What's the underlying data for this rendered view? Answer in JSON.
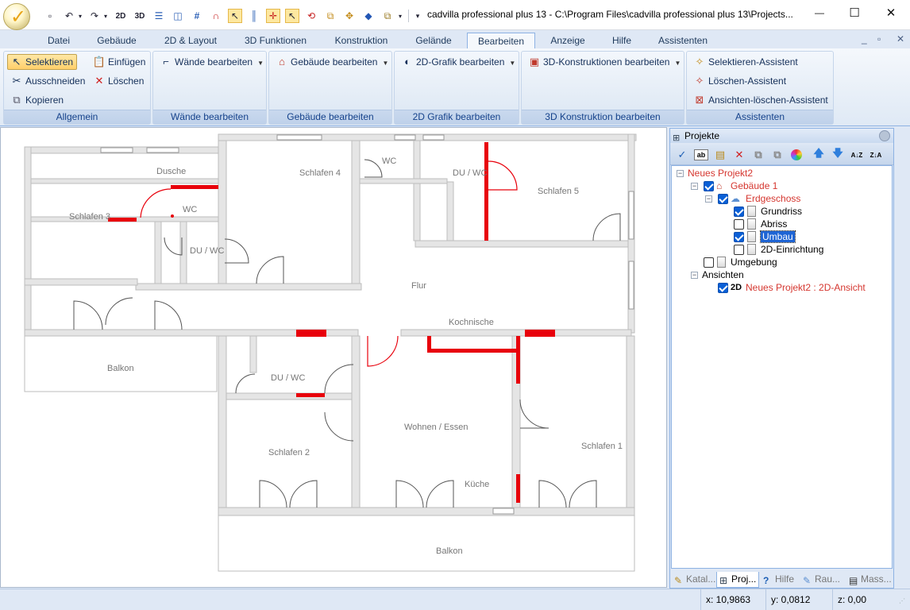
{
  "window": {
    "title": "cadvilla professional plus 13 - C:\\Program Files\\cadvilla professional plus 13\\Projects...",
    "minimize": "—",
    "maximize": "☐",
    "close": "✕"
  },
  "quick_access": {
    "buttons": [
      {
        "icon": "new-document-icon",
        "glyph": "▫"
      },
      {
        "icon": "undo-icon",
        "glyph": "↶"
      },
      {
        "icon": "redo-icon",
        "glyph": "↷"
      },
      {
        "icon": "view-2d-icon",
        "glyph": "2D"
      },
      {
        "icon": "view-3d-icon",
        "glyph": "3D"
      },
      {
        "icon": "split-horizontal-icon",
        "glyph": "☰"
      },
      {
        "icon": "split-vertical-icon",
        "glyph": "◫"
      },
      {
        "icon": "grid-icon",
        "glyph": "#"
      },
      {
        "icon": "magnet-icon",
        "glyph": "∩"
      },
      {
        "icon": "select-tool-icon",
        "glyph": "↖"
      },
      {
        "icon": "columns-icon",
        "glyph": "║"
      },
      {
        "icon": "snap-cross-icon",
        "glyph": "✛"
      },
      {
        "icon": "pointer-icon",
        "glyph": "↖"
      },
      {
        "icon": "rotate-icon",
        "glyph": "⟲"
      },
      {
        "icon": "mirror-icon",
        "glyph": "⧉"
      },
      {
        "icon": "move-icon",
        "glyph": "✥"
      },
      {
        "icon": "eraser-icon",
        "glyph": "◆"
      },
      {
        "icon": "copy-icon",
        "glyph": "⧉"
      }
    ],
    "more": "▾"
  },
  "ribbon": {
    "tabs": [
      "Datei",
      "Gebäude",
      "2D & Layout",
      "3D Funktionen",
      "Konstruktion",
      "Gelände",
      "Bearbeiten",
      "Anzeige",
      "Hilfe",
      "Assistenten"
    ],
    "active_tab": "Bearbeiten",
    "mdi_controls": [
      "_",
      "▫",
      "✕"
    ],
    "groups": {
      "allgemein": {
        "label": "Allgemein",
        "selektieren": "Selektieren",
        "einfuegen": "Einfügen",
        "ausschneiden": "Ausschneiden",
        "loeschen": "Löschen",
        "kopieren": "Kopieren"
      },
      "waende": {
        "label": "Wände bearbeiten",
        "button": "Wände bearbeiten"
      },
      "gebaeude": {
        "label": "Gebäude bearbeiten",
        "button": "Gebäude bearbeiten"
      },
      "grafik2d": {
        "label": "2D Grafik bearbeiten",
        "button": "2D-Grafik bearbeiten"
      },
      "konstruktion3d": {
        "label": "3D Konstruktion bearbeiten",
        "button": "3D-Konstruktionen bearbeiten"
      },
      "assistenten": {
        "label": "Assistenten",
        "selektieren": "Selektieren-Assistent",
        "loeschen": "Löschen-Assistent",
        "ansichten": "Ansichten-löschen-Assistent"
      }
    }
  },
  "floorplan": {
    "rooms": {
      "dusche": "Dusche",
      "schlafen4": "Schlafen 4",
      "wc_top": "WC",
      "duwc_top": "DU / WC",
      "schlafen5": "Schlafen 5",
      "schlafen3": "Schlafen 3",
      "wc_mid": "WC",
      "duwc_left": "DU / WC",
      "flur": "Flur",
      "kochnische": "Kochnische",
      "balkon_left": "Balkon",
      "duwc_center": "DU / WC",
      "wohnen": "Wohnen / Essen",
      "schlafen2": "Schlafen 2",
      "schlafen1": "Schlafen 1",
      "kueche": "Küche",
      "balkon_bottom": "Balkon"
    }
  },
  "projects_panel": {
    "title": "Projekte",
    "tree": {
      "root": "Neues Projekt2",
      "building": "Gebäude 1",
      "floor": "Erdgeschoss",
      "grundriss": "Grundriss",
      "abriss": "Abriss",
      "umbau": "Umbau",
      "einrichtung": "2D-Einrichtung",
      "umgebung": "Umgebung",
      "ansichten": "Ansichten",
      "view": "Neues Projekt2 : 2D-Ansicht",
      "view_badge": "2D"
    },
    "checks": {
      "building": true,
      "floor": true,
      "grundriss": true,
      "abriss": false,
      "umbau": true,
      "einrichtung": false,
      "umgebung": false,
      "view": true
    },
    "tabs": [
      "Katal...",
      "Proj...",
      "Hilfe",
      "Rau...",
      "Mass..."
    ],
    "active_tab": "Proj..."
  },
  "statusbar": {
    "x": "x: 10,9863",
    "y": "y: 0,0812",
    "z": "z: 0,00"
  },
  "colors": {
    "accent": "#f5c94c",
    "ribbon_text": "#15428b",
    "highlight_wall": "#e8000b",
    "wall_gray": "#e4e4e4",
    "tree_red": "#d5362f"
  }
}
